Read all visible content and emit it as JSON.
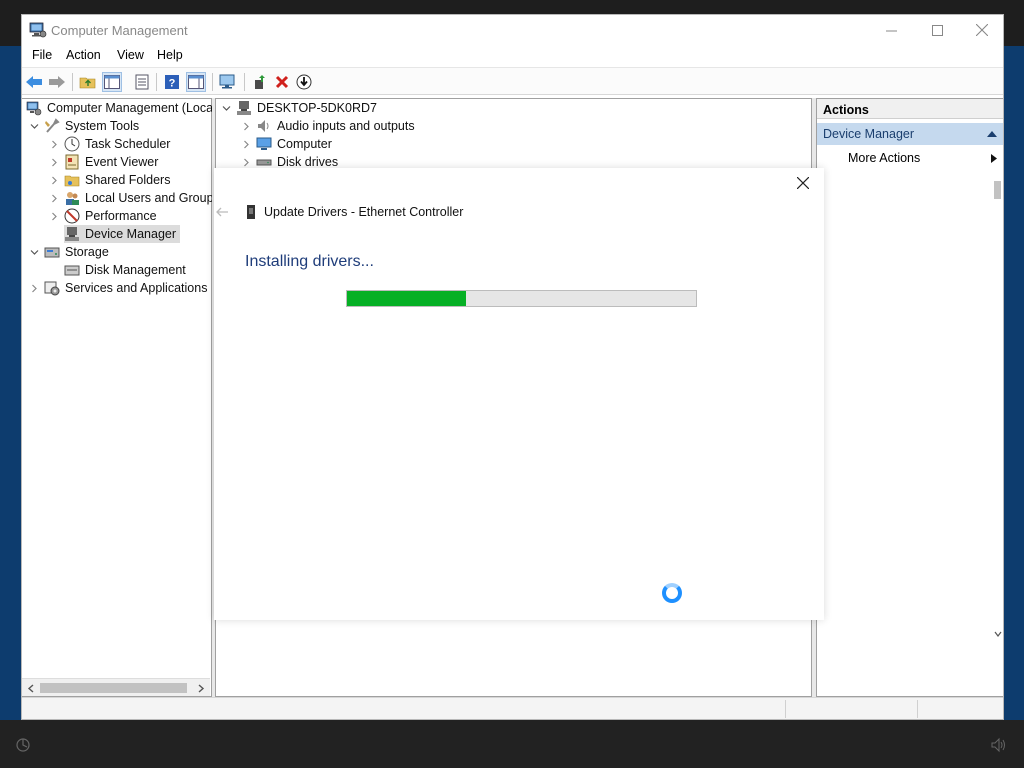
{
  "window": {
    "title": "Computer Management"
  },
  "menu": [
    "File",
    "Action",
    "View",
    "Help"
  ],
  "toolbar_icons": [
    "back-icon",
    "forward-icon",
    "up-folder-icon",
    "show-hide-tree-icon",
    "properties-icon",
    "help-icon",
    "show-action-pane-icon",
    "monitor-icon",
    "scan-hardware-icon",
    "uninstall-icon",
    "update-driver-icon"
  ],
  "left_tree": {
    "root": "Computer Management (Local",
    "items": [
      {
        "label": "System Tools"
      },
      {
        "label": "Task Scheduler"
      },
      {
        "label": "Event Viewer"
      },
      {
        "label": "Shared Folders"
      },
      {
        "label": "Local Users and Groups"
      },
      {
        "label": "Performance"
      },
      {
        "label": "Device Manager"
      },
      {
        "label": "Storage"
      },
      {
        "label": "Disk Management"
      },
      {
        "label": "Services and Applications"
      }
    ]
  },
  "device_tree": {
    "root": "DESKTOP-5DK0RD7",
    "items": [
      {
        "label": "Audio inputs and outputs"
      },
      {
        "label": "Computer"
      },
      {
        "label": "Disk drives"
      }
    ]
  },
  "actions_pane": {
    "header": "Actions",
    "selected": "Device Manager",
    "item": "More Actions"
  },
  "dialog": {
    "title": "Update Drivers - Ethernet Controller",
    "heading": "Installing drivers...",
    "progress": 0.34
  },
  "colors": {
    "progress_fill": "#06b025",
    "desktop_blue": "#0d3c6e",
    "heading_blue": "#1f3d7a"
  }
}
